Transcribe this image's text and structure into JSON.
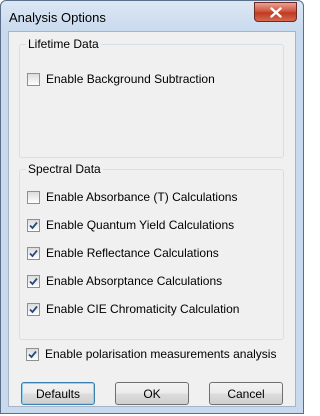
{
  "dialog": {
    "title": "Analysis Options"
  },
  "lifetime": {
    "label": "Lifetime Data",
    "options": [
      {
        "label": "Enable Background Subtraction",
        "checked": false
      }
    ]
  },
  "spectral": {
    "label": "Spectral Data",
    "options": [
      {
        "label": "Enable Absorbance (T) Calculations",
        "checked": false
      },
      {
        "label": "Enable Quantum Yield Calculations",
        "checked": true
      },
      {
        "label": "Enable Reflectance Calculations",
        "checked": true
      },
      {
        "label": "Enable Absorptance Calculations",
        "checked": true
      },
      {
        "label": "Enable CIE Chromaticity Calculation",
        "checked": true
      }
    ]
  },
  "polarisation": {
    "label": "Enable polarisation measurements analysis",
    "checked": true
  },
  "buttons": {
    "defaults": "Defaults",
    "ok": "OK",
    "cancel": "Cancel"
  },
  "colors": {
    "close_button": "#c8422a",
    "default_button_border": "#3c7fb1",
    "check_mark": "#2b4a7a"
  }
}
